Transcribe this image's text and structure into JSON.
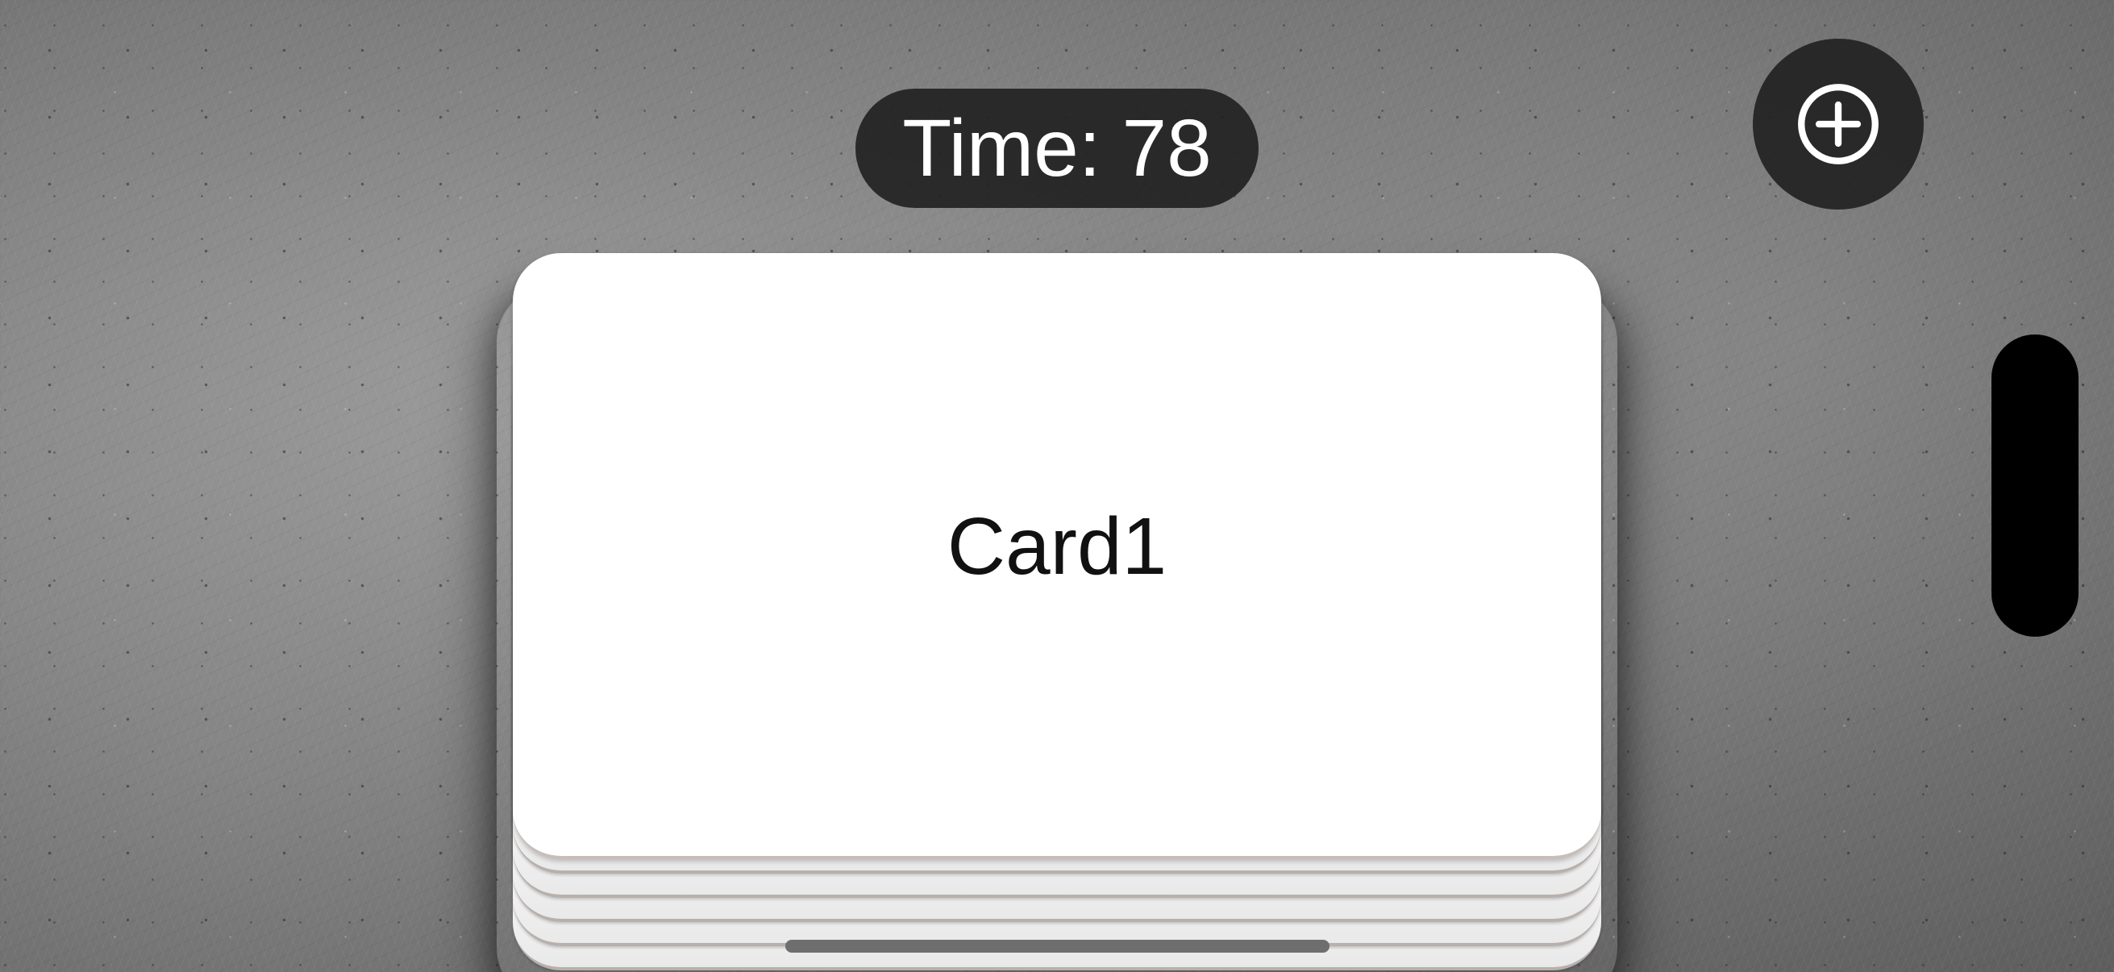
{
  "timer": {
    "label": "Time:",
    "value": "78"
  },
  "add_button": {
    "icon": "plus-circle-icon"
  },
  "card": {
    "label": "Card1",
    "stack_layers_visible": 5
  },
  "colors": {
    "pill_background": "#222222",
    "card_background": "#ffffff",
    "side_bar": "#000000",
    "text_on_pill": "#ffffff",
    "card_text": "#111111"
  }
}
